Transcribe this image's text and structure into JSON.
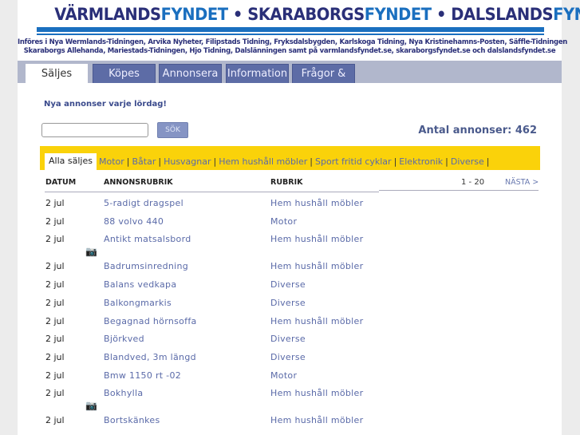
{
  "header": {
    "logo_parts": [
      "VÄRMLANDS",
      "FYNDET",
      " • SKARABORGS",
      "FYNDET",
      " • DALSLANDS",
      "FYNDET"
    ],
    "sub1": "Införes i Nya Wermlands-Tidningen, Arvika Nyheter, Filipstads Tidning, Fryksdalsbygden, Karlskoga Tidning, Nya Kristinehamns-Posten, Säffle-Tidningen",
    "sub2": "Skaraborgs Allehanda, Mariestads-Tidningen, Hjo Tidning, Dalslänningen samt på varmlandsfyndet.se, skaraborgsfyndet.se och dalslandsfyndet.se"
  },
  "nav": {
    "tabs": [
      "Säljes",
      "Köpes",
      "Annonsera",
      "Information",
      "Frågor & svar"
    ]
  },
  "notice": "Nya annonser varje lördag!",
  "search": {
    "value": "",
    "button": "SÖK"
  },
  "count": "Antal annonser: 462",
  "categories": [
    "Alla säljes",
    "Motor",
    "Båtar",
    "Husvagnar",
    "Hem hushåll möbler",
    "Sport fritid cyklar",
    "Elektronik",
    "Diverse"
  ],
  "table": {
    "headers": [
      "DATUM",
      "ANNONSRUBRIK",
      "RUBRIK"
    ],
    "paging": "1 - 20",
    "next": "NÄSTA >",
    "rows": [
      {
        "date": "2 jul",
        "title": "5-radigt dragspel",
        "category": "Hem hushåll möbler",
        "image": false
      },
      {
        "date": "2 jul",
        "title": "88 volvo 440",
        "category": "Motor",
        "image": false
      },
      {
        "date": "2 jul",
        "title": "Antikt matsalsbord",
        "category": "Hem hushåll möbler",
        "image": true
      },
      {
        "date": "2 jul",
        "title": "Badrumsinredning",
        "category": "Hem hushåll möbler",
        "image": false
      },
      {
        "date": "2 jul",
        "title": "Balans vedkapa",
        "category": "Diverse",
        "image": false
      },
      {
        "date": "2 jul",
        "title": "Balkongmarkis",
        "category": "Diverse",
        "image": false
      },
      {
        "date": "2 jul",
        "title": "Begagnad hörnsoffa",
        "category": "Hem hushåll möbler",
        "image": false
      },
      {
        "date": "2 jul",
        "title": "Björkved",
        "category": "Diverse",
        "image": false
      },
      {
        "date": "2 jul",
        "title": "Blandved, 3m längd",
        "category": "Diverse",
        "image": false
      },
      {
        "date": "2 jul",
        "title": "Bmw 1150 rt -02",
        "category": "Motor",
        "image": false
      },
      {
        "date": "2 jul",
        "title": "Bokhylla",
        "category": "Hem hushåll möbler",
        "image": true
      },
      {
        "date": "2 jul",
        "title": "Bortskänkes",
        "category": "Hem hushåll möbler",
        "image": false
      }
    ]
  },
  "colors": {
    "brand_dark": "#2a2f78",
    "brand_blue": "#1a6fbf",
    "tab": "#5d6ca6",
    "category_bar": "#fad20a",
    "link": "#5a6aa8"
  },
  "icons": {
    "image_indicator": "camera-icon"
  }
}
